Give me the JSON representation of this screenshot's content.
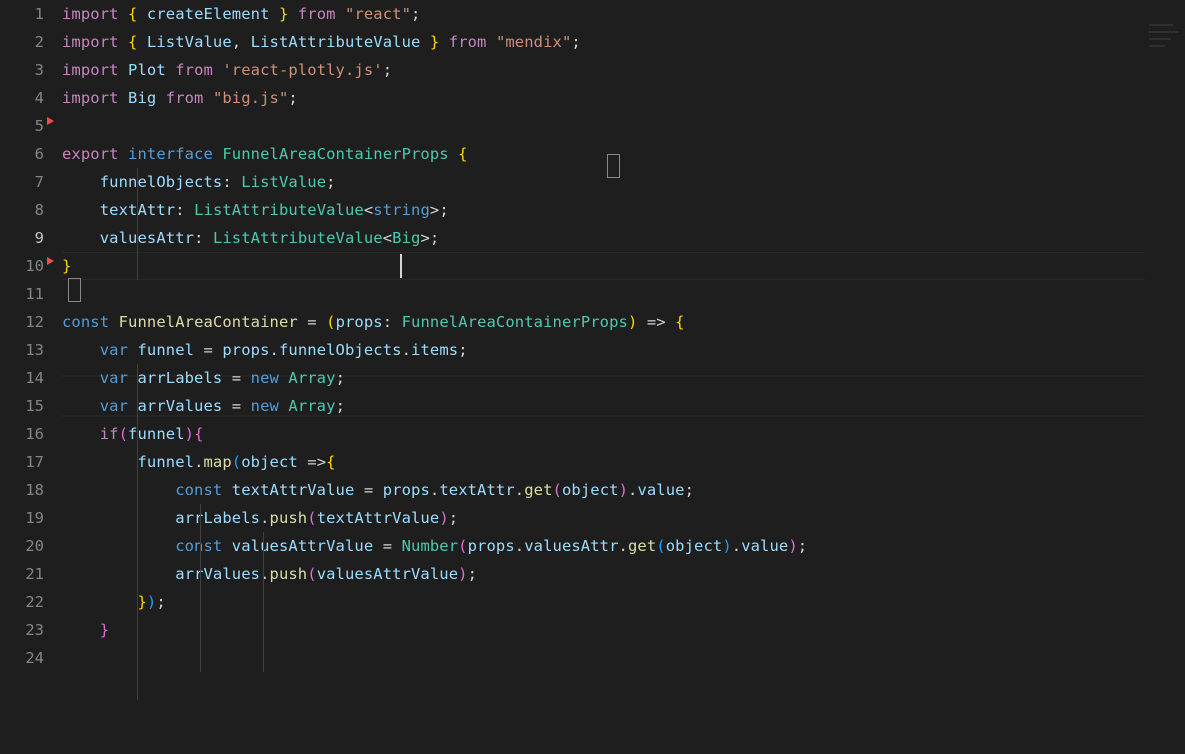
{
  "editor": {
    "theme": "dark-plus",
    "language": "typescript",
    "background_color": "#1e1e1e",
    "gutter_color": "#1e1e1e",
    "line_number_color": "#858585",
    "active_line_number_color": "#c6c6c6",
    "active_line": 9,
    "cursor_line": 9,
    "cursor_column": 37,
    "total_visible_lines": 24,
    "line_height_px": 28,
    "first_visible_line": 1,
    "colors": {
      "keyword_control": "#c586c0",
      "keyword_storage": "#569cd6",
      "type": "#4ec9b0",
      "variable": "#9cdcfe",
      "function": "#dcdcaa",
      "string": "#ce9178",
      "punctuation": "#d4d4d4",
      "bracket_level_1": "#ffd700",
      "bracket_level_2": "#da70d6",
      "bracket_level_3": "#179fff",
      "change_marker": "#f14c4c",
      "indent_guide": "#404040",
      "bracket_match_border": "#888888"
    },
    "change_markers": [
      4,
      9
    ],
    "bracket_match_lines": [
      6,
      10
    ]
  },
  "lines": [
    {
      "n": 1,
      "text": "import { createElement } from \"react\";"
    },
    {
      "n": 2,
      "text": "import { ListValue, ListAttributeValue } from \"mendix\";"
    },
    {
      "n": 3,
      "text": "import Plot from 'react-plotly.js';"
    },
    {
      "n": 4,
      "text": "import Big from \"big.js\";"
    },
    {
      "n": 5,
      "text": ""
    },
    {
      "n": 6,
      "text": "export interface FunnelAreaContainerProps {"
    },
    {
      "n": 7,
      "text": "    funnelObjects: ListValue;"
    },
    {
      "n": 8,
      "text": "    textAttr: ListAttributeValue<string>;"
    },
    {
      "n": 9,
      "text": "    valuesAttr: ListAttributeValue<Big>;"
    },
    {
      "n": 10,
      "text": "}"
    },
    {
      "n": 11,
      "text": ""
    },
    {
      "n": 12,
      "text": "const FunnelAreaContainer = (props: FunnelAreaContainerProps) => {"
    },
    {
      "n": 13,
      "text": "    var funnel = props.funnelObjects.items;"
    },
    {
      "n": 14,
      "text": "    var arrLabels = new Array;"
    },
    {
      "n": 15,
      "text": "    var arrValues = new Array;"
    },
    {
      "n": 16,
      "text": "    if(funnel){"
    },
    {
      "n": 17,
      "text": "        funnel.map(object =>{"
    },
    {
      "n": 18,
      "text": "            const textAttrValue = props.textAttr.get(object).value;"
    },
    {
      "n": 19,
      "text": "            arrLabels.push(textAttrValue);"
    },
    {
      "n": 20,
      "text": "            const valuesAttrValue = Number(props.valuesAttr.get(object).value);"
    },
    {
      "n": 21,
      "text": "            arrValues.push(valuesAttrValue);"
    },
    {
      "n": 22,
      "text": "        });"
    },
    {
      "n": 23,
      "text": "    }"
    },
    {
      "n": 24,
      "text": ""
    }
  ],
  "line_numbers": [
    "1",
    "2",
    "3",
    "4",
    "5",
    "6",
    "7",
    "8",
    "9",
    "10",
    "11",
    "12",
    "13",
    "14",
    "15",
    "16",
    "17",
    "18",
    "19",
    "20",
    "21",
    "22",
    "23",
    "24"
  ],
  "tokens": {
    "l1": [
      {
        "t": "import",
        "c": "t-key"
      },
      {
        "t": " ",
        "c": "t-plain"
      },
      {
        "t": "{",
        "c": "t-b1"
      },
      {
        "t": " ",
        "c": "t-plain"
      },
      {
        "t": "createElement",
        "c": "t-var"
      },
      {
        "t": " ",
        "c": "t-plain"
      },
      {
        "t": "}",
        "c": "t-b1"
      },
      {
        "t": " ",
        "c": "t-plain"
      },
      {
        "t": "from",
        "c": "t-key"
      },
      {
        "t": " ",
        "c": "t-plain"
      },
      {
        "t": "\"react\"",
        "c": "t-str"
      },
      {
        "t": ";",
        "c": "t-plain"
      }
    ],
    "l2": [
      {
        "t": "import",
        "c": "t-key"
      },
      {
        "t": " ",
        "c": "t-plain"
      },
      {
        "t": "{",
        "c": "t-b1"
      },
      {
        "t": " ",
        "c": "t-plain"
      },
      {
        "t": "ListValue",
        "c": "t-var"
      },
      {
        "t": ", ",
        "c": "t-plain"
      },
      {
        "t": "ListAttributeValue",
        "c": "t-var"
      },
      {
        "t": " ",
        "c": "t-plain"
      },
      {
        "t": "}",
        "c": "t-b1"
      },
      {
        "t": " ",
        "c": "t-plain"
      },
      {
        "t": "from",
        "c": "t-key"
      },
      {
        "t": " ",
        "c": "t-plain"
      },
      {
        "t": "\"mendix\"",
        "c": "t-str"
      },
      {
        "t": ";",
        "c": "t-plain"
      }
    ],
    "l3": [
      {
        "t": "import",
        "c": "t-key"
      },
      {
        "t": " ",
        "c": "t-plain"
      },
      {
        "t": "Plot",
        "c": "t-var"
      },
      {
        "t": " ",
        "c": "t-plain"
      },
      {
        "t": "from",
        "c": "t-key"
      },
      {
        "t": " ",
        "c": "t-plain"
      },
      {
        "t": "'react-plotly.js'",
        "c": "t-str"
      },
      {
        "t": ";",
        "c": "t-plain"
      }
    ],
    "l4": [
      {
        "t": "import",
        "c": "t-key"
      },
      {
        "t": " ",
        "c": "t-plain"
      },
      {
        "t": "Big",
        "c": "t-var"
      },
      {
        "t": " ",
        "c": "t-plain"
      },
      {
        "t": "from",
        "c": "t-key"
      },
      {
        "t": " ",
        "c": "t-plain"
      },
      {
        "t": "\"big.js\"",
        "c": "t-str"
      },
      {
        "t": ";",
        "c": "t-plain"
      }
    ],
    "l6": [
      {
        "t": "export",
        "c": "t-key"
      },
      {
        "t": " ",
        "c": "t-plain"
      },
      {
        "t": "interface",
        "c": "t-kw-blue"
      },
      {
        "t": " ",
        "c": "t-plain"
      },
      {
        "t": "FunnelAreaContainerProps",
        "c": "t-type"
      },
      {
        "t": " ",
        "c": "t-plain"
      },
      {
        "t": "{",
        "c": "t-b1"
      }
    ],
    "l7": [
      {
        "t": "    ",
        "c": "t-plain"
      },
      {
        "t": "funnelObjects",
        "c": "t-var"
      },
      {
        "t": ": ",
        "c": "t-plain"
      },
      {
        "t": "ListValue",
        "c": "t-type"
      },
      {
        "t": ";",
        "c": "t-plain"
      }
    ],
    "l8": [
      {
        "t": "    ",
        "c": "t-plain"
      },
      {
        "t": "textAttr",
        "c": "t-var"
      },
      {
        "t": ": ",
        "c": "t-plain"
      },
      {
        "t": "ListAttributeValue",
        "c": "t-type"
      },
      {
        "t": "<",
        "c": "t-plain"
      },
      {
        "t": "string",
        "c": "t-kw-blue"
      },
      {
        "t": ">",
        "c": "t-plain"
      },
      {
        "t": ";",
        "c": "t-plain"
      }
    ],
    "l9": [
      {
        "t": "    ",
        "c": "t-plain"
      },
      {
        "t": "valuesAttr",
        "c": "t-var"
      },
      {
        "t": ": ",
        "c": "t-plain"
      },
      {
        "t": "ListAttributeValue",
        "c": "t-type"
      },
      {
        "t": "<",
        "c": "t-plain"
      },
      {
        "t": "Big",
        "c": "t-type"
      },
      {
        "t": ">",
        "c": "t-plain"
      },
      {
        "t": ";",
        "c": "t-plain"
      }
    ],
    "l10": [
      {
        "t": "}",
        "c": "t-b1"
      }
    ],
    "l12": [
      {
        "t": "const",
        "c": "t-kw-blue"
      },
      {
        "t": " ",
        "c": "t-plain"
      },
      {
        "t": "FunnelAreaContainer",
        "c": "t-func"
      },
      {
        "t": " = ",
        "c": "t-plain"
      },
      {
        "t": "(",
        "c": "t-b1"
      },
      {
        "t": "props",
        "c": "t-var"
      },
      {
        "t": ": ",
        "c": "t-plain"
      },
      {
        "t": "FunnelAreaContainerProps",
        "c": "t-type"
      },
      {
        "t": ")",
        "c": "t-b1"
      },
      {
        "t": " => ",
        "c": "t-plain"
      },
      {
        "t": "{",
        "c": "t-b1"
      }
    ],
    "l13": [
      {
        "t": "    ",
        "c": "t-plain"
      },
      {
        "t": "var",
        "c": "t-kw-blue"
      },
      {
        "t": " ",
        "c": "t-plain"
      },
      {
        "t": "funnel",
        "c": "t-var"
      },
      {
        "t": " = ",
        "c": "t-plain"
      },
      {
        "t": "props",
        "c": "t-var"
      },
      {
        "t": ".",
        "c": "t-plain"
      },
      {
        "t": "funnelObjects",
        "c": "t-var"
      },
      {
        "t": ".",
        "c": "t-plain"
      },
      {
        "t": "items",
        "c": "t-var"
      },
      {
        "t": ";",
        "c": "t-plain"
      }
    ],
    "l14": [
      {
        "t": "    ",
        "c": "t-plain"
      },
      {
        "t": "var",
        "c": "t-kw-blue"
      },
      {
        "t": " ",
        "c": "t-plain"
      },
      {
        "t": "arrLabels",
        "c": "t-var"
      },
      {
        "t": " = ",
        "c": "t-plain"
      },
      {
        "t": "new",
        "c": "t-kw-blue"
      },
      {
        "t": " ",
        "c": "t-plain"
      },
      {
        "t": "Array",
        "c": "t-type"
      },
      {
        "t": ";",
        "c": "t-plain"
      }
    ],
    "l15": [
      {
        "t": "    ",
        "c": "t-plain"
      },
      {
        "t": "var",
        "c": "t-kw-blue"
      },
      {
        "t": " ",
        "c": "t-plain"
      },
      {
        "t": "arrValues",
        "c": "t-var"
      },
      {
        "t": " = ",
        "c": "t-plain"
      },
      {
        "t": "new",
        "c": "t-kw-blue"
      },
      {
        "t": " ",
        "c": "t-plain"
      },
      {
        "t": "Array",
        "c": "t-type"
      },
      {
        "t": ";",
        "c": "t-plain"
      }
    ],
    "l16": [
      {
        "t": "    ",
        "c": "t-plain"
      },
      {
        "t": "if",
        "c": "t-key"
      },
      {
        "t": "(",
        "c": "t-b2"
      },
      {
        "t": "funnel",
        "c": "t-var"
      },
      {
        "t": ")",
        "c": "t-b2"
      },
      {
        "t": "{",
        "c": "t-b2"
      }
    ],
    "l17": [
      {
        "t": "        ",
        "c": "t-plain"
      },
      {
        "t": "funnel",
        "c": "t-var"
      },
      {
        "t": ".",
        "c": "t-plain"
      },
      {
        "t": "map",
        "c": "t-func"
      },
      {
        "t": "(",
        "c": "t-b3"
      },
      {
        "t": "object",
        "c": "t-var"
      },
      {
        "t": " =>",
        "c": "t-plain"
      },
      {
        "t": "{",
        "c": "t-b1"
      }
    ],
    "l18": [
      {
        "t": "            ",
        "c": "t-plain"
      },
      {
        "t": "const",
        "c": "t-kw-blue"
      },
      {
        "t": " ",
        "c": "t-plain"
      },
      {
        "t": "textAttrValue",
        "c": "t-var"
      },
      {
        "t": " = ",
        "c": "t-plain"
      },
      {
        "t": "props",
        "c": "t-var"
      },
      {
        "t": ".",
        "c": "t-plain"
      },
      {
        "t": "textAttr",
        "c": "t-var"
      },
      {
        "t": ".",
        "c": "t-plain"
      },
      {
        "t": "get",
        "c": "t-func"
      },
      {
        "t": "(",
        "c": "t-b2"
      },
      {
        "t": "object",
        "c": "t-var"
      },
      {
        "t": ")",
        "c": "t-b2"
      },
      {
        "t": ".",
        "c": "t-plain"
      },
      {
        "t": "value",
        "c": "t-var"
      },
      {
        "t": ";",
        "c": "t-plain"
      }
    ],
    "l19": [
      {
        "t": "            ",
        "c": "t-plain"
      },
      {
        "t": "arrLabels",
        "c": "t-var"
      },
      {
        "t": ".",
        "c": "t-plain"
      },
      {
        "t": "push",
        "c": "t-func"
      },
      {
        "t": "(",
        "c": "t-b2"
      },
      {
        "t": "textAttrValue",
        "c": "t-var"
      },
      {
        "t": ")",
        "c": "t-b2"
      },
      {
        "t": ";",
        "c": "t-plain"
      }
    ],
    "l20": [
      {
        "t": "            ",
        "c": "t-plain"
      },
      {
        "t": "const",
        "c": "t-kw-blue"
      },
      {
        "t": " ",
        "c": "t-plain"
      },
      {
        "t": "valuesAttrValue",
        "c": "t-var"
      },
      {
        "t": " = ",
        "c": "t-plain"
      },
      {
        "t": "Number",
        "c": "t-type"
      },
      {
        "t": "(",
        "c": "t-b2"
      },
      {
        "t": "props",
        "c": "t-var"
      },
      {
        "t": ".",
        "c": "t-plain"
      },
      {
        "t": "valuesAttr",
        "c": "t-var"
      },
      {
        "t": ".",
        "c": "t-plain"
      },
      {
        "t": "get",
        "c": "t-func"
      },
      {
        "t": "(",
        "c": "t-b3"
      },
      {
        "t": "object",
        "c": "t-var"
      },
      {
        "t": ")",
        "c": "t-b3"
      },
      {
        "t": ".",
        "c": "t-plain"
      },
      {
        "t": "value",
        "c": "t-var"
      },
      {
        "t": ")",
        "c": "t-b2"
      },
      {
        "t": ";",
        "c": "t-plain"
      }
    ],
    "l21": [
      {
        "t": "            ",
        "c": "t-plain"
      },
      {
        "t": "arrValues",
        "c": "t-var"
      },
      {
        "t": ".",
        "c": "t-plain"
      },
      {
        "t": "push",
        "c": "t-func"
      },
      {
        "t": "(",
        "c": "t-b2"
      },
      {
        "t": "valuesAttrValue",
        "c": "t-var"
      },
      {
        "t": ")",
        "c": "t-b2"
      },
      {
        "t": ";",
        "c": "t-plain"
      }
    ],
    "l22": [
      {
        "t": "        ",
        "c": "t-plain"
      },
      {
        "t": "}",
        "c": "t-b1"
      },
      {
        "t": ")",
        "c": "t-b3"
      },
      {
        "t": ";",
        "c": "t-plain"
      }
    ],
    "l23": [
      {
        "t": "    ",
        "c": "t-plain"
      },
      {
        "t": "}",
        "c": "t-b2"
      }
    ]
  }
}
